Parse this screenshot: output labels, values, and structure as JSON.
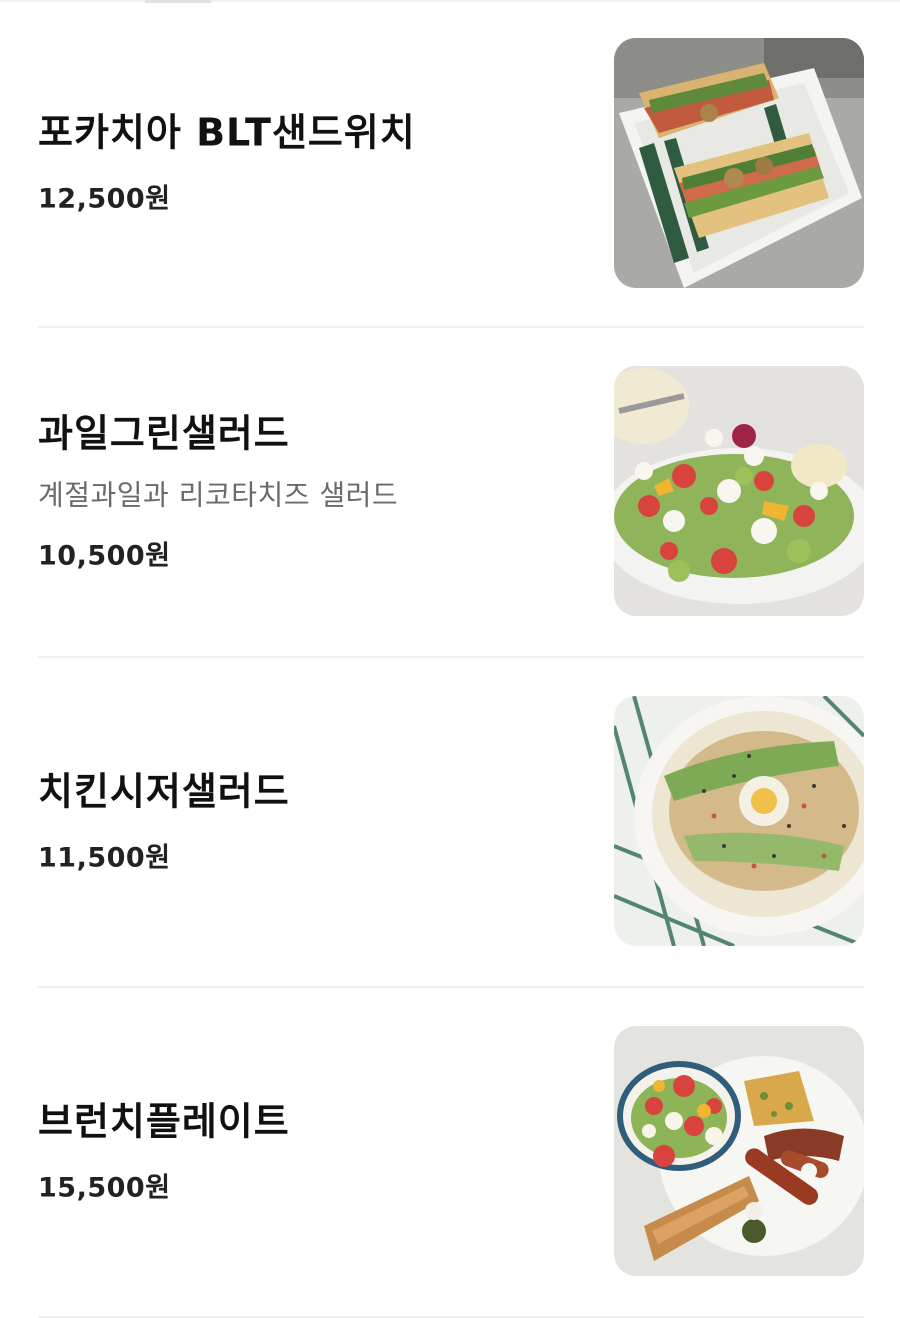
{
  "menu": {
    "items": [
      {
        "name": "포카치아 BLT샌드위치",
        "description": "",
        "price": "12,500원",
        "image_icon": "sandwich-photo"
      },
      {
        "name": "과일그린샐러드",
        "description": "계절과일과 리코타치즈 샐러드",
        "price": "10,500원",
        "image_icon": "fruit-salad-photo"
      },
      {
        "name": "치킨시저샐러드",
        "description": "",
        "price": "11,500원",
        "image_icon": "caesar-salad-photo"
      },
      {
        "name": "브런치플레이트",
        "description": "",
        "price": "15,500원",
        "image_icon": "brunch-plate-photo"
      }
    ]
  },
  "colors": {
    "divider": "#efefef",
    "text": "#111111",
    "description": "#6a6a6a"
  }
}
